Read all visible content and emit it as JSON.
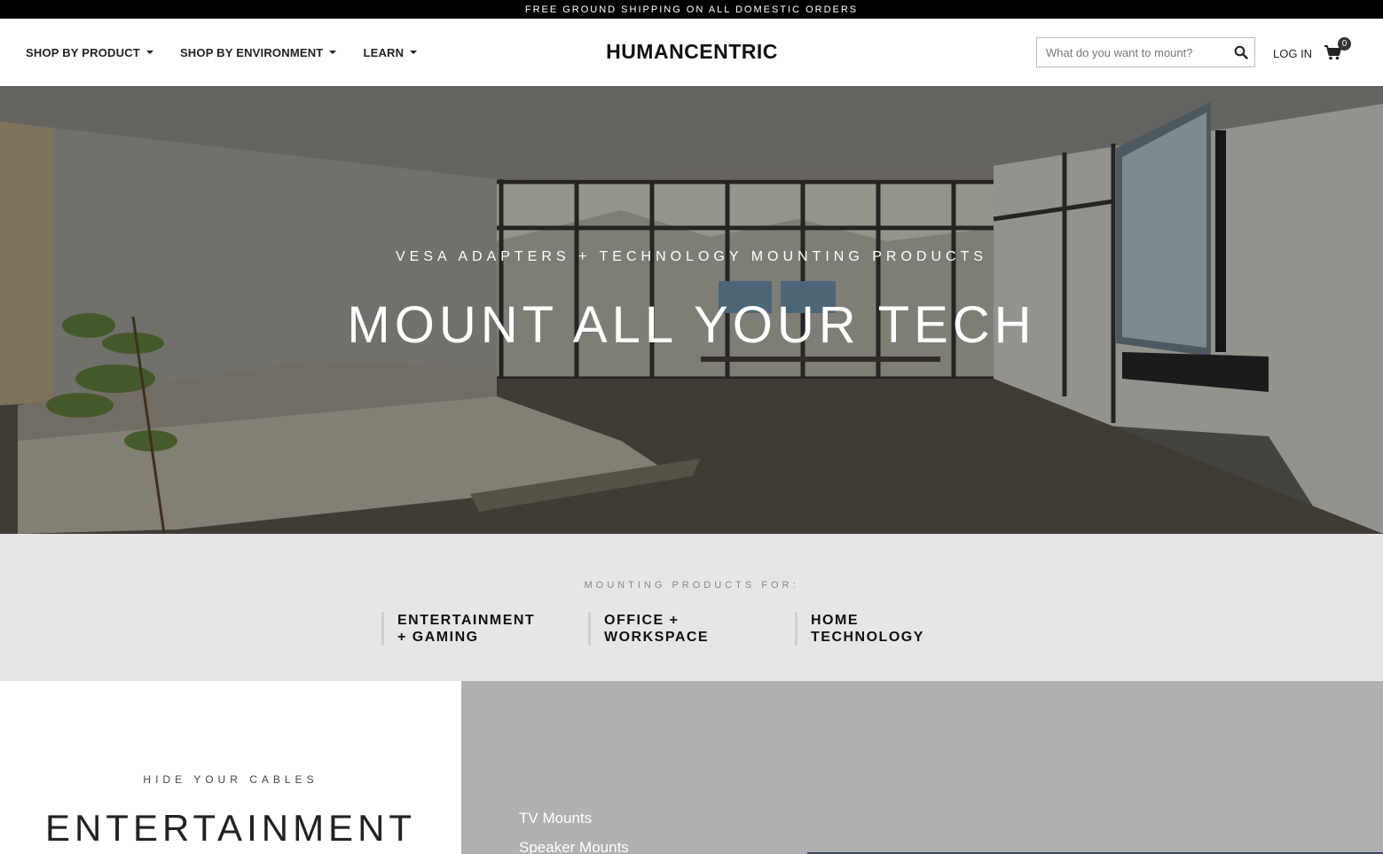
{
  "topbar": {
    "text": "FREE GROUND SHIPPING ON ALL DOMESTIC ORDERS"
  },
  "nav": {
    "items": [
      {
        "label": "SHOP BY PRODUCT"
      },
      {
        "label": "SHOP BY ENVIRONMENT"
      },
      {
        "label": "LEARN"
      }
    ]
  },
  "logo": {
    "text": "HUMANCENTRIC"
  },
  "search": {
    "placeholder": "What do you want to mount?",
    "value": ""
  },
  "account": {
    "login_label": "LOG IN",
    "cart_count": "0"
  },
  "hero": {
    "subtitle": "VESA ADAPTERS + TECHNOLOGY MOUNTING PRODUCTS",
    "title": "MOUNT ALL YOUR TECH"
  },
  "categories": {
    "label": "MOUNTING PRODUCTS FOR:",
    "items": [
      {
        "line1": "ENTERTAINMENT",
        "line2": "+ GAMING"
      },
      {
        "line1": "OFFICE +",
        "line2": "WORKSPACE"
      },
      {
        "line1": "HOME",
        "line2": "TECHNOLOGY"
      }
    ]
  },
  "feature": {
    "kicker": "HIDE YOUR CABLES",
    "title": "ENTERTAINMENT",
    "links": [
      "TV Mounts",
      "Speaker Mounts"
    ]
  },
  "icons": {
    "search": "search-icon",
    "cart": "cart-icon",
    "caret": "caret-down-icon"
  }
}
